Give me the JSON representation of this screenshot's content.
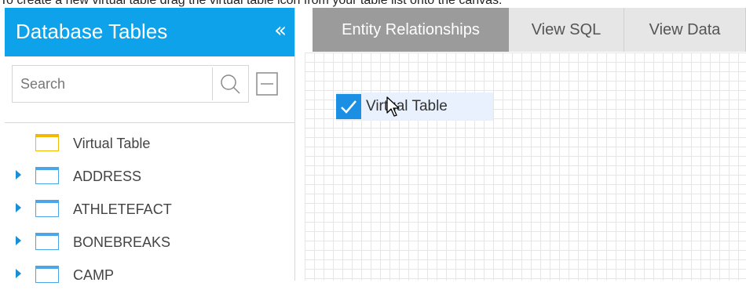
{
  "instruction": "To create a new virtual table drag the virtual table icon from your table list onto the canvas.",
  "left_panel": {
    "title": "Database Tables",
    "collapse_glyph": "«",
    "search": {
      "placeholder": "Search",
      "value": ""
    },
    "icons": {
      "search": "search-icon",
      "collapse_all": "collapse-all-icon"
    },
    "tables": [
      {
        "label": "Virtual Table",
        "type": "virtual",
        "expandable": false
      },
      {
        "label": "ADDRESS",
        "type": "table",
        "expandable": true
      },
      {
        "label": "ATHLETEFACT",
        "type": "table",
        "expandable": true
      },
      {
        "label": "BONEBREAKS",
        "type": "table",
        "expandable": true
      },
      {
        "label": "CAMP",
        "type": "table",
        "expandable": true
      }
    ]
  },
  "tabs": [
    {
      "label": "Entity Relationships",
      "active": true
    },
    {
      "label": "View SQL",
      "active": false
    },
    {
      "label": "View Data",
      "active": false
    }
  ],
  "canvas": {
    "table": {
      "label": "Virtual Table",
      "checked": true
    }
  },
  "colors": {
    "header_blue": "#0da2ea",
    "checkbox_blue": "#1a8fe3",
    "virtual_icon_yellow": "#f5b800",
    "active_tab_gray": "#9b9b9b"
  }
}
